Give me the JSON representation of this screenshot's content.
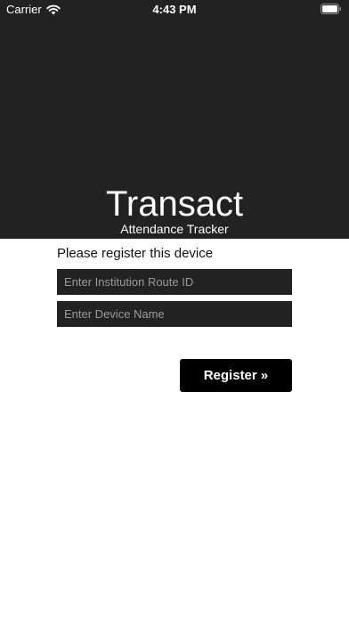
{
  "status_bar": {
    "carrier": "Carrier",
    "time": "4:43 PM",
    "wifi_icon": "wifi-icon",
    "battery_icon": "battery-icon"
  },
  "header": {
    "title": "Transact",
    "subtitle": "Attendance Tracker",
    "background_color": "#222222"
  },
  "form": {
    "heading": "Please register this device",
    "route_id_placeholder": "Enter Institution Route ID",
    "route_id_value": "",
    "device_name_placeholder": "Enter Device Name",
    "device_name_value": "",
    "register_label": "Register »"
  }
}
